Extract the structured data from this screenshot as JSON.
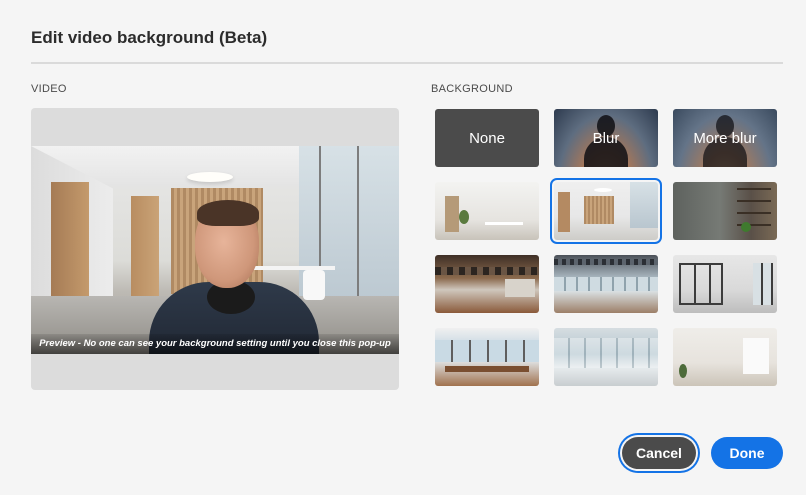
{
  "dialog": {
    "title": "Edit video background (Beta)"
  },
  "video": {
    "section_label": "VIDEO",
    "preview_caption": "Preview - No one can see your background setting until you close this pop-up"
  },
  "background": {
    "section_label": "BACKGROUND",
    "options": [
      {
        "label": "None",
        "kind": "none"
      },
      {
        "label": "Blur",
        "kind": "blur"
      },
      {
        "label": "More blur",
        "kind": "more-blur"
      },
      {
        "label": "",
        "kind": "image",
        "selected": false
      },
      {
        "label": "",
        "kind": "image",
        "selected": true
      },
      {
        "label": "",
        "kind": "image",
        "selected": false
      },
      {
        "label": "",
        "kind": "image",
        "selected": false
      },
      {
        "label": "",
        "kind": "image",
        "selected": false
      },
      {
        "label": "",
        "kind": "image",
        "selected": false
      },
      {
        "label": "",
        "kind": "image",
        "selected": false
      },
      {
        "label": "",
        "kind": "image",
        "selected": false
      },
      {
        "label": "",
        "kind": "image",
        "selected": false
      }
    ]
  },
  "actions": {
    "cancel_label": "Cancel",
    "done_label": "Done"
  },
  "colors": {
    "accent": "#1473e6",
    "dialog_background": "#f5f5f5",
    "secondary_button": "#4b4b4b"
  }
}
